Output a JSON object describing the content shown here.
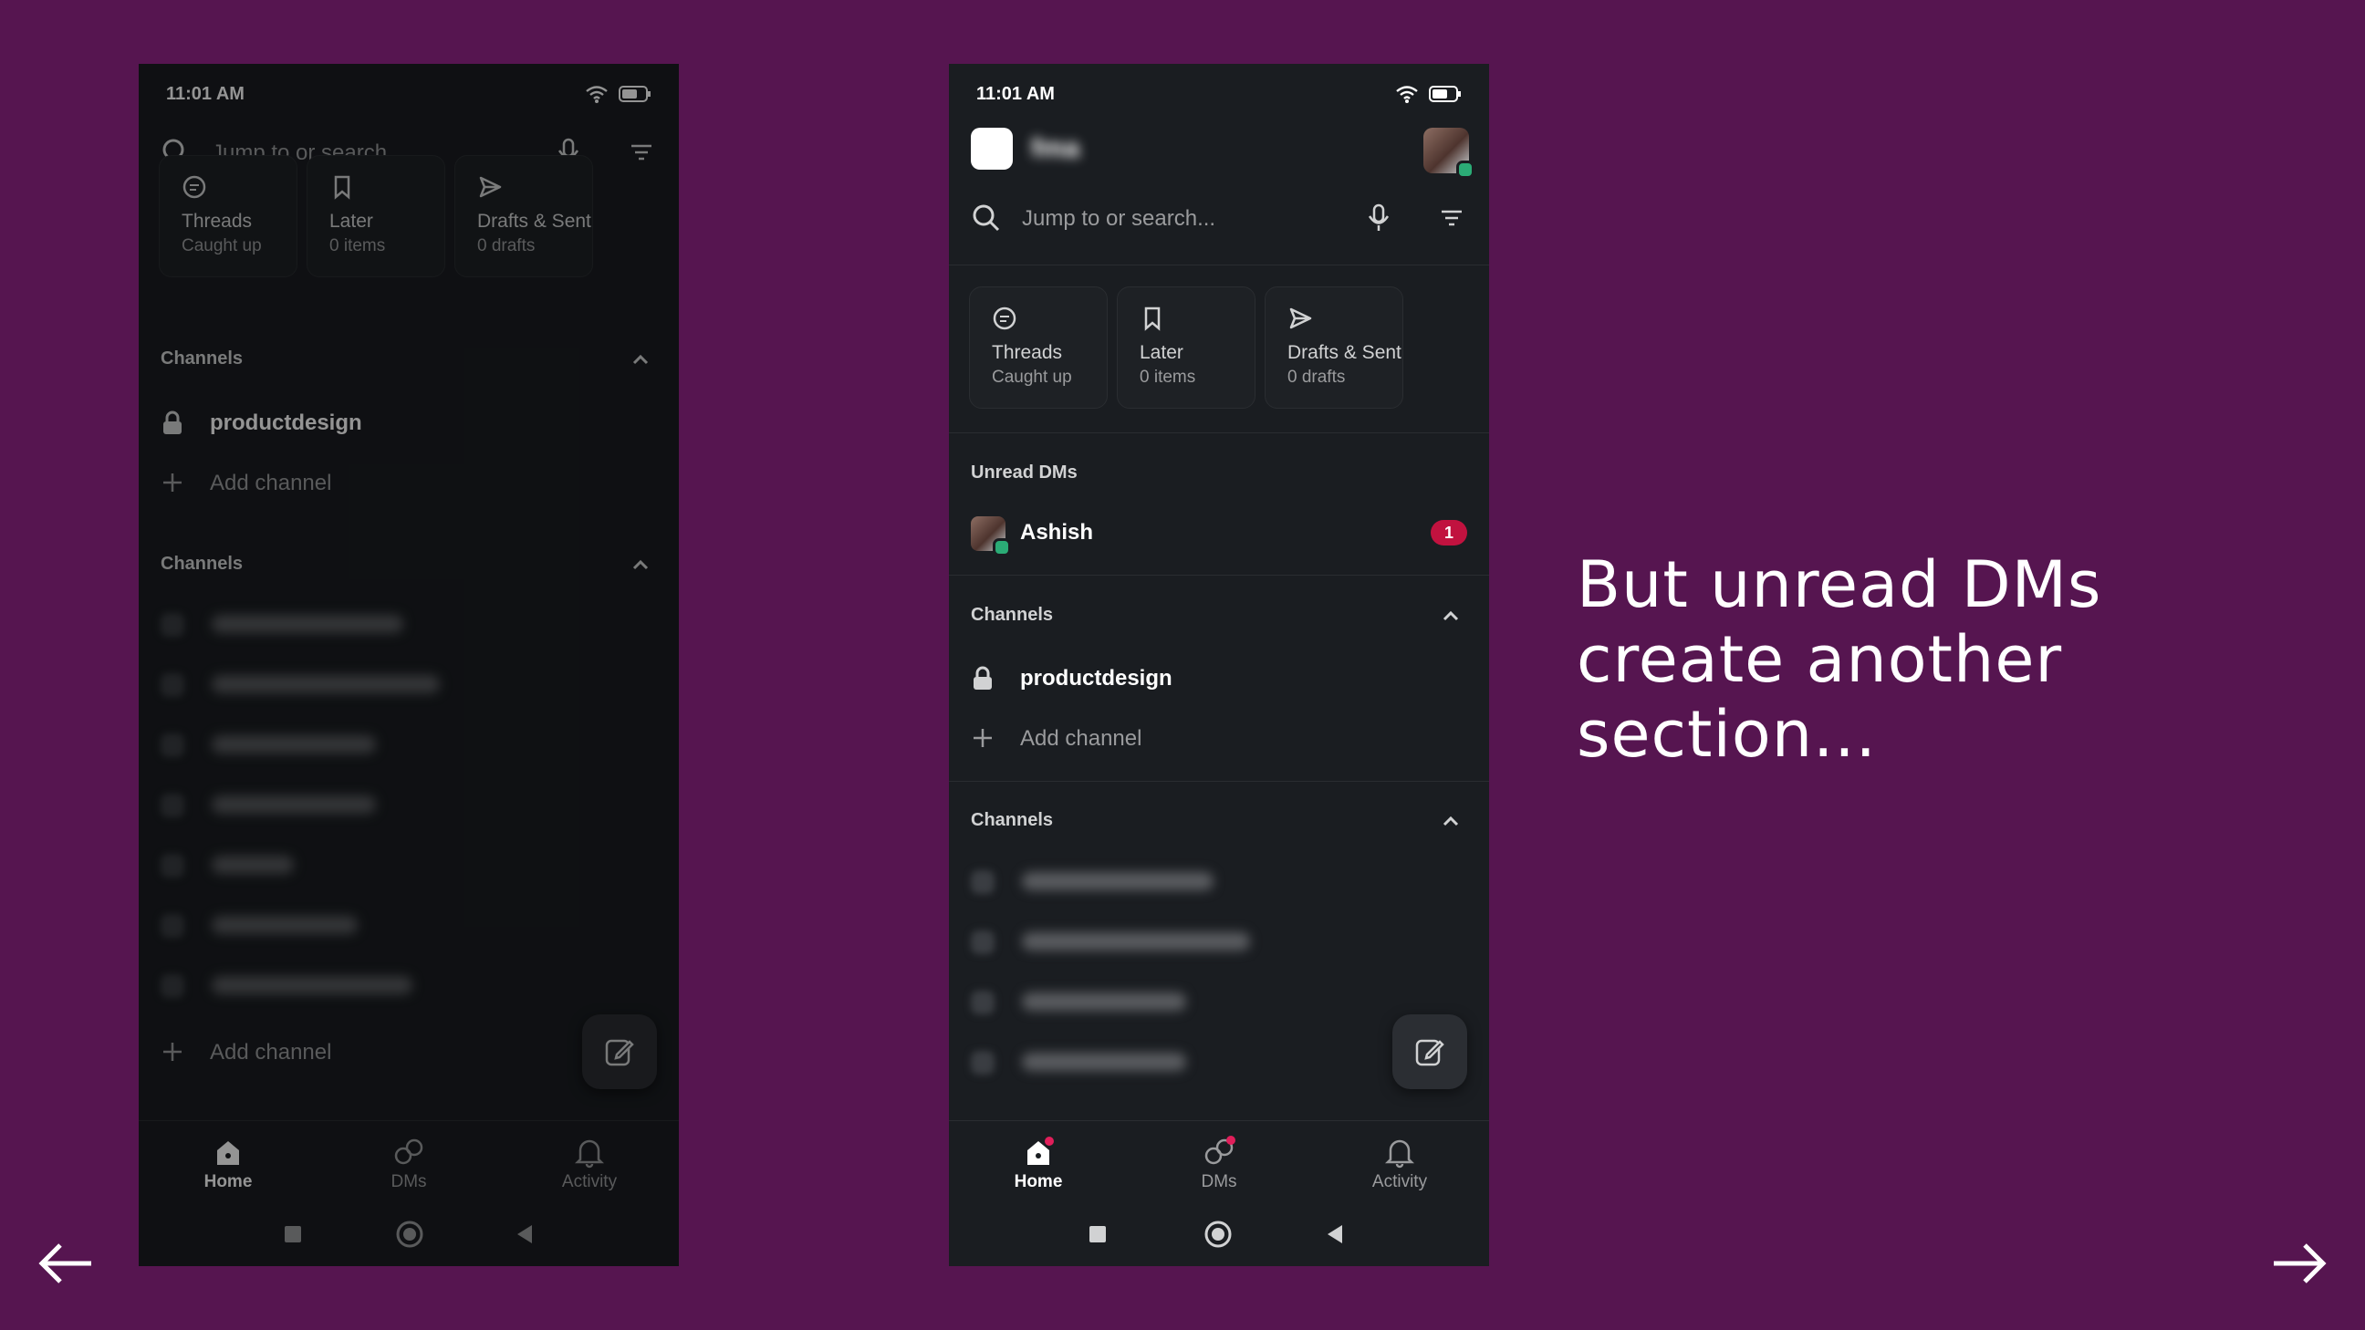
{
  "status": {
    "time": "11:01 AM",
    "battery": "53"
  },
  "workspace": {
    "name": "fma"
  },
  "search": {
    "placeholder": "Jump to or search..."
  },
  "cards": [
    {
      "title": "Threads",
      "subtitle": "Caught up",
      "icon": "threads-icon"
    },
    {
      "title": "Later",
      "subtitle": "0 items",
      "icon": "bookmark-icon"
    },
    {
      "title": "Drafts & Sent",
      "subtitle": "0 drafts",
      "icon": "send-icon"
    }
  ],
  "unread_dms": {
    "title": "Unread DMs",
    "items": [
      {
        "name": "Ashish",
        "count": "1"
      }
    ]
  },
  "channels_section": {
    "title": "Channels",
    "channel": "productdesign",
    "add_label": "Add channel"
  },
  "channels_section2": {
    "title": "Channels",
    "blurred_channels": [
      "daily video updates",
      "meme gifs short videos",
      "pm dashboard 3",
      "release feedback",
      "team ui",
      "ux design room",
      "ux product thread"
    ],
    "add_label": "Add channel"
  },
  "tabs": [
    {
      "label": "Home",
      "icon": "home-icon"
    },
    {
      "label": "DMs",
      "icon": "dms-icon"
    },
    {
      "label": "Activity",
      "icon": "bell-icon"
    }
  ],
  "caption": {
    "lines": [
      "But unread DMs",
      "create another",
      "section..."
    ]
  },
  "colors": {
    "background": "#561550",
    "app_bg": "#1a1d21",
    "badge": "#c1123f",
    "online": "#2bac76"
  }
}
